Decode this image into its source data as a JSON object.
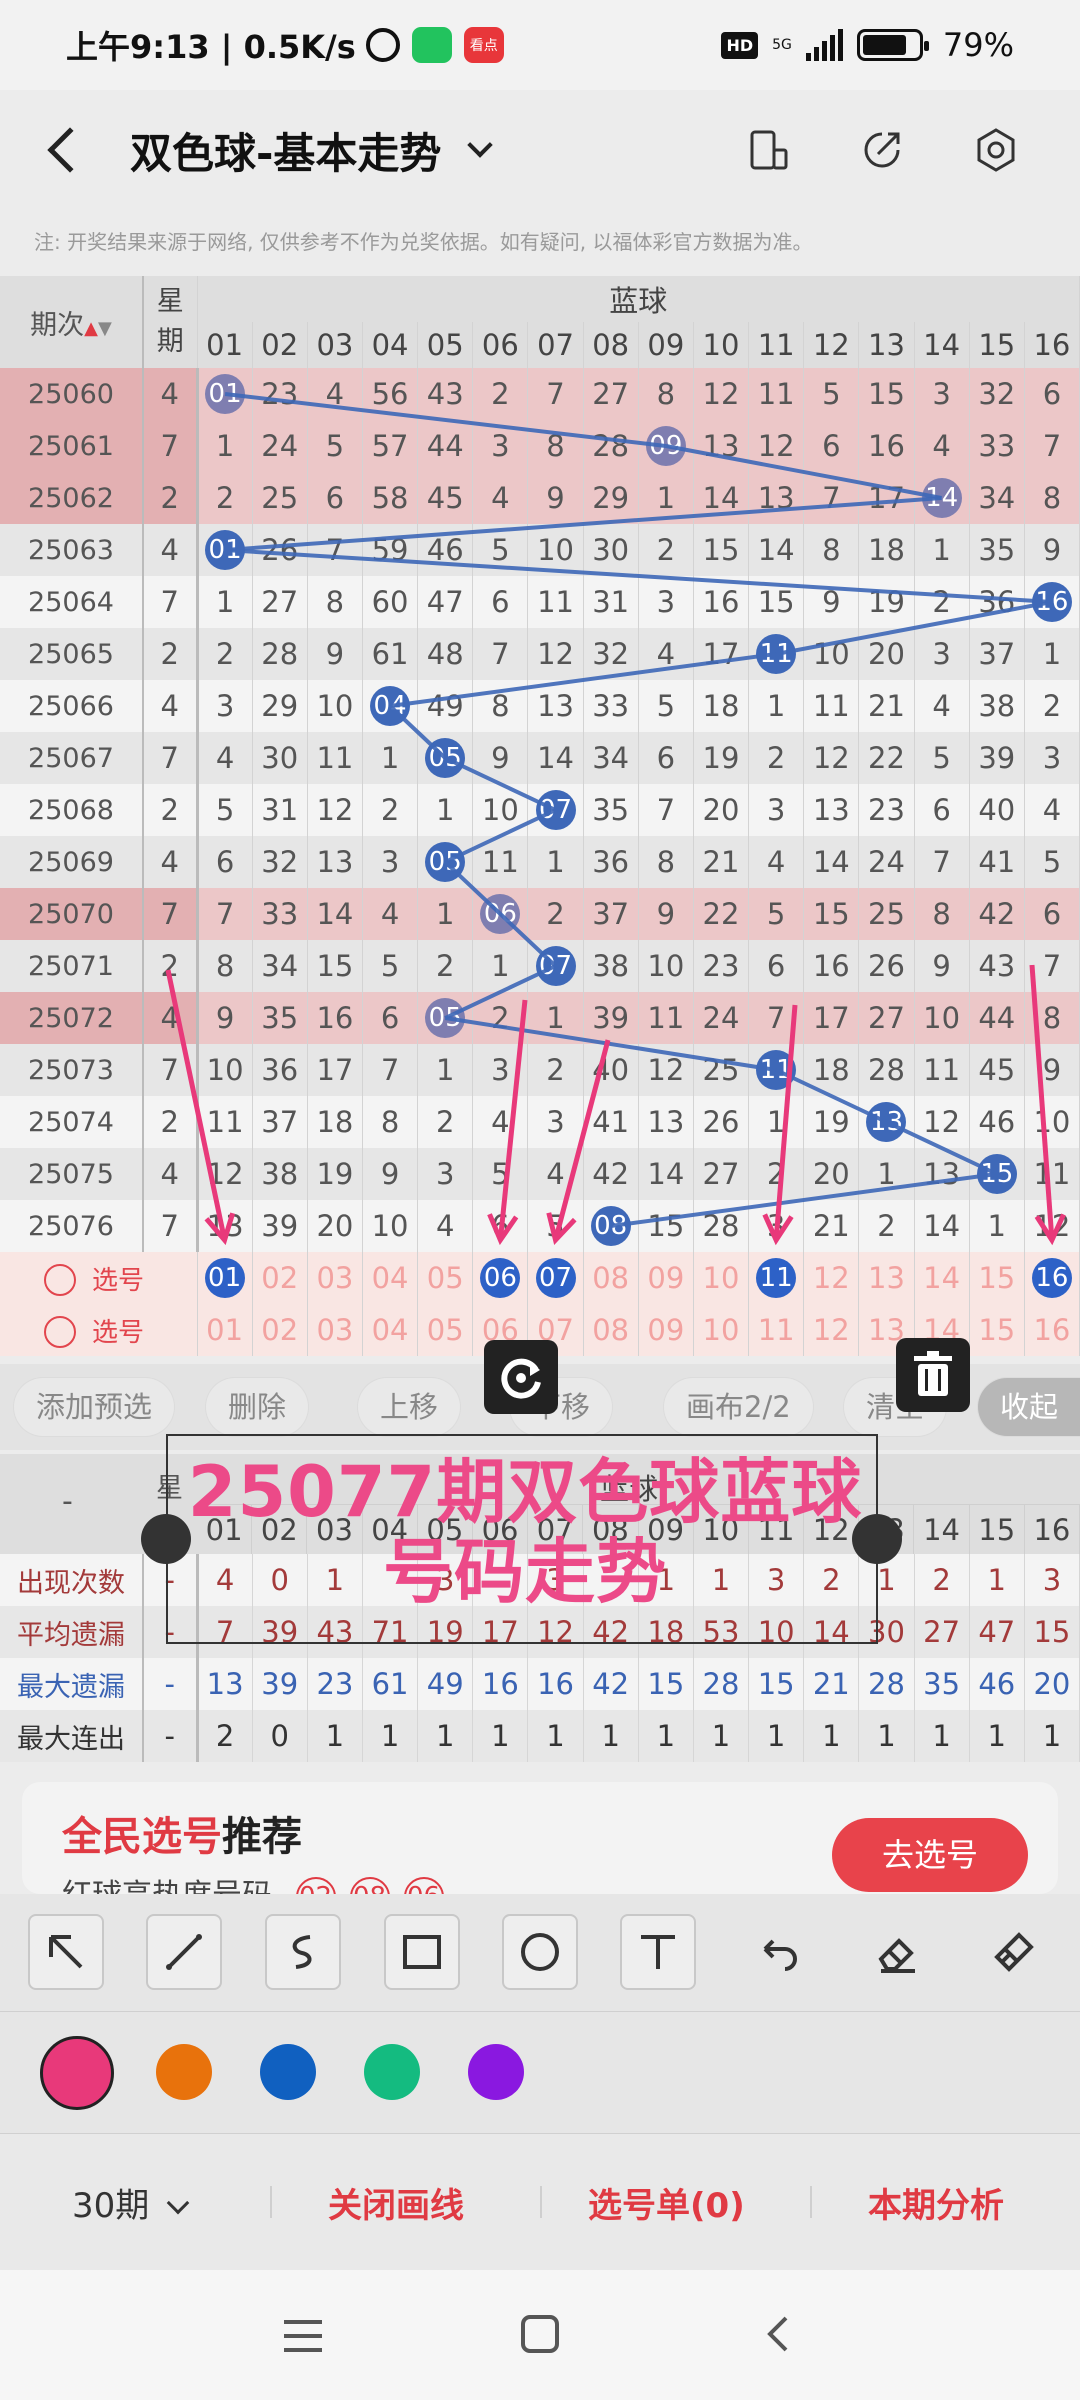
{
  "status_bar": {
    "time_text": "上午9:13 | 0.5K/s",
    "network": "5G",
    "hd": "HD",
    "battery": "79%",
    "news_badge": "看点"
  },
  "header": {
    "title": "双色球-基本走势",
    "icons": [
      "back-icon",
      "chevron-down-icon",
      "device-icon",
      "share-icon",
      "settings-icon"
    ]
  },
  "notice": "注: 开奖结果来源于网络, 仅供参考不作为兑奖依据。如有疑问, 以福体彩官方数据为准。",
  "table": {
    "period_header": "期次",
    "week_header": "星期",
    "blue_header": "蓝球",
    "numbers": [
      "01",
      "02",
      "03",
      "04",
      "05",
      "06",
      "07",
      "08",
      "09",
      "10",
      "11",
      "12",
      "13",
      "14",
      "15",
      "16"
    ],
    "rows": [
      {
        "period": "25060",
        "week": "4",
        "ball": 1,
        "cells": [
          "01",
          "23",
          "4",
          "56",
          "43",
          "2",
          "7",
          "27",
          "8",
          "12",
          "11",
          "5",
          "15",
          "3",
          "32",
          "6"
        ],
        "highlight": true
      },
      {
        "period": "25061",
        "week": "7",
        "ball": 9,
        "cells": [
          "1",
          "24",
          "5",
          "57",
          "44",
          "3",
          "8",
          "28",
          "09",
          "13",
          "12",
          "6",
          "16",
          "4",
          "33",
          "7"
        ],
        "highlight": true
      },
      {
        "period": "25062",
        "week": "2",
        "ball": 14,
        "cells": [
          "2",
          "25",
          "6",
          "58",
          "45",
          "4",
          "9",
          "29",
          "1",
          "14",
          "13",
          "7",
          "17",
          "14",
          "34",
          "8"
        ],
        "highlight": true
      },
      {
        "period": "25063",
        "week": "4",
        "ball": 1,
        "cells": [
          "01",
          "26",
          "7",
          "59",
          "46",
          "5",
          "10",
          "30",
          "2",
          "15",
          "14",
          "8",
          "18",
          "1",
          "35",
          "9"
        ],
        "highlight": false
      },
      {
        "period": "25064",
        "week": "7",
        "ball": 16,
        "cells": [
          "1",
          "27",
          "8",
          "60",
          "47",
          "6",
          "11",
          "31",
          "3",
          "16",
          "15",
          "9",
          "19",
          "2",
          "36",
          "16"
        ],
        "highlight": false
      },
      {
        "period": "25065",
        "week": "2",
        "ball": 11,
        "cells": [
          "2",
          "28",
          "9",
          "61",
          "48",
          "7",
          "12",
          "32",
          "4",
          "17",
          "11",
          "10",
          "20",
          "3",
          "37",
          "1"
        ],
        "highlight": false
      },
      {
        "period": "25066",
        "week": "4",
        "ball": 4,
        "cells": [
          "3",
          "29",
          "10",
          "04",
          "49",
          "8",
          "13",
          "33",
          "5",
          "18",
          "1",
          "11",
          "21",
          "4",
          "38",
          "2"
        ],
        "highlight": false
      },
      {
        "period": "25067",
        "week": "7",
        "ball": 5,
        "cells": [
          "4",
          "30",
          "11",
          "1",
          "05",
          "9",
          "14",
          "34",
          "6",
          "19",
          "2",
          "12",
          "22",
          "5",
          "39",
          "3"
        ],
        "highlight": false
      },
      {
        "period": "25068",
        "week": "2",
        "ball": 7,
        "cells": [
          "5",
          "31",
          "12",
          "2",
          "1",
          "10",
          "07",
          "35",
          "7",
          "20",
          "3",
          "13",
          "23",
          "6",
          "40",
          "4"
        ],
        "highlight": false
      },
      {
        "period": "25069",
        "week": "4",
        "ball": 5,
        "cells": [
          "6",
          "32",
          "13",
          "3",
          "05",
          "11",
          "1",
          "36",
          "8",
          "21",
          "4",
          "14",
          "24",
          "7",
          "41",
          "5"
        ],
        "highlight": false
      },
      {
        "period": "25070",
        "week": "7",
        "ball": 6,
        "cells": [
          "7",
          "33",
          "14",
          "4",
          "1",
          "06",
          "2",
          "37",
          "9",
          "22",
          "5",
          "15",
          "25",
          "8",
          "42",
          "6"
        ],
        "highlight": true
      },
      {
        "period": "25071",
        "week": "2",
        "ball": 7,
        "cells": [
          "8",
          "34",
          "15",
          "5",
          "2",
          "1",
          "07",
          "38",
          "10",
          "23",
          "6",
          "16",
          "26",
          "9",
          "43",
          "7"
        ],
        "highlight": false
      },
      {
        "period": "25072",
        "week": "4",
        "ball": 5,
        "cells": [
          "9",
          "35",
          "16",
          "6",
          "05",
          "2",
          "1",
          "39",
          "11",
          "24",
          "7",
          "17",
          "27",
          "10",
          "44",
          "8"
        ],
        "highlight": true
      },
      {
        "period": "25073",
        "week": "7",
        "ball": 11,
        "cells": [
          "10",
          "36",
          "17",
          "7",
          "1",
          "3",
          "2",
          "40",
          "12",
          "25",
          "11",
          "18",
          "28",
          "11",
          "45",
          "9"
        ],
        "highlight": false
      },
      {
        "period": "25074",
        "week": "2",
        "ball": 13,
        "cells": [
          "11",
          "37",
          "18",
          "8",
          "2",
          "4",
          "3",
          "41",
          "13",
          "26",
          "1",
          "19",
          "13",
          "12",
          "46",
          "10"
        ],
        "highlight": false
      },
      {
        "period": "25075",
        "week": "4",
        "ball": 15,
        "cells": [
          "12",
          "38",
          "19",
          "9",
          "3",
          "5",
          "4",
          "42",
          "14",
          "27",
          "2",
          "20",
          "1",
          "13",
          "15",
          "11"
        ],
        "highlight": false
      },
      {
        "period": "25076",
        "week": "7",
        "ball": 8,
        "cells": [
          "13",
          "39",
          "20",
          "10",
          "4",
          "6",
          "5",
          "08",
          "15",
          "28",
          "3",
          "21",
          "2",
          "14",
          "1",
          "12"
        ],
        "highlight": false
      }
    ],
    "pick_label": "选号",
    "pick_row_1_selected": [
      1,
      6,
      7,
      11,
      16
    ]
  },
  "actions": {
    "add": "添加预选",
    "delete": "删除",
    "up": "上移",
    "down": "下移",
    "canvas": "画布2/2",
    "clear": "清空",
    "collapse": "收起"
  },
  "stats": {
    "week_header": "星",
    "blue_header": "蓝球",
    "dash": "-",
    "rows": [
      {
        "label": "出现次数",
        "values": [
          "4",
          "0",
          "1",
          "",
          "3",
          "",
          "3",
          "",
          "1",
          "1",
          "3",
          "2",
          "1",
          "2",
          "1",
          "3"
        ]
      },
      {
        "label": "平均遗漏",
        "values": [
          "7",
          "39",
          "43",
          "71",
          "19",
          "17",
          "12",
          "42",
          "18",
          "53",
          "10",
          "14",
          "30",
          "27",
          "47",
          "15"
        ]
      },
      {
        "label": "最大遗漏",
        "values": [
          "13",
          "39",
          "23",
          "61",
          "49",
          "16",
          "16",
          "42",
          "15",
          "28",
          "15",
          "21",
          "28",
          "35",
          "46",
          "20"
        ]
      },
      {
        "label": "最大连出",
        "values": [
          "2",
          "0",
          "1",
          "1",
          "1",
          "1",
          "1",
          "1",
          "1",
          "1",
          "1",
          "1",
          "1",
          "1",
          "1",
          "1"
        ]
      }
    ]
  },
  "annotation_text": [
    "25077期双色球蓝球",
    "号码走势"
  ],
  "recommend": {
    "title_red": "全民选号",
    "title_rest": "推荐",
    "subtitle": "红球高热度号码",
    "balls": [
      "02",
      "08",
      "06"
    ],
    "button": "去选号"
  },
  "tools": [
    "arrow-tool-icon",
    "line-tool-icon",
    "curve-tool-icon",
    "rectangle-tool-icon",
    "circle-tool-icon",
    "text-tool-icon",
    "undo-icon",
    "eraser-icon",
    "clear-tool-icon"
  ],
  "colors": {
    "pink": "#e8397a",
    "orange": "#e8720c",
    "blue": "#1060c0",
    "green": "#14bb80",
    "purple": "#8a18e0",
    "ball_blue": "#3e68b8",
    "red_text": "#e03a43"
  },
  "bottom_bar": {
    "period_select": "30期",
    "close_lines": "关闭画线",
    "pick_list": "选号单(0)",
    "analysis": "本期分析"
  }
}
